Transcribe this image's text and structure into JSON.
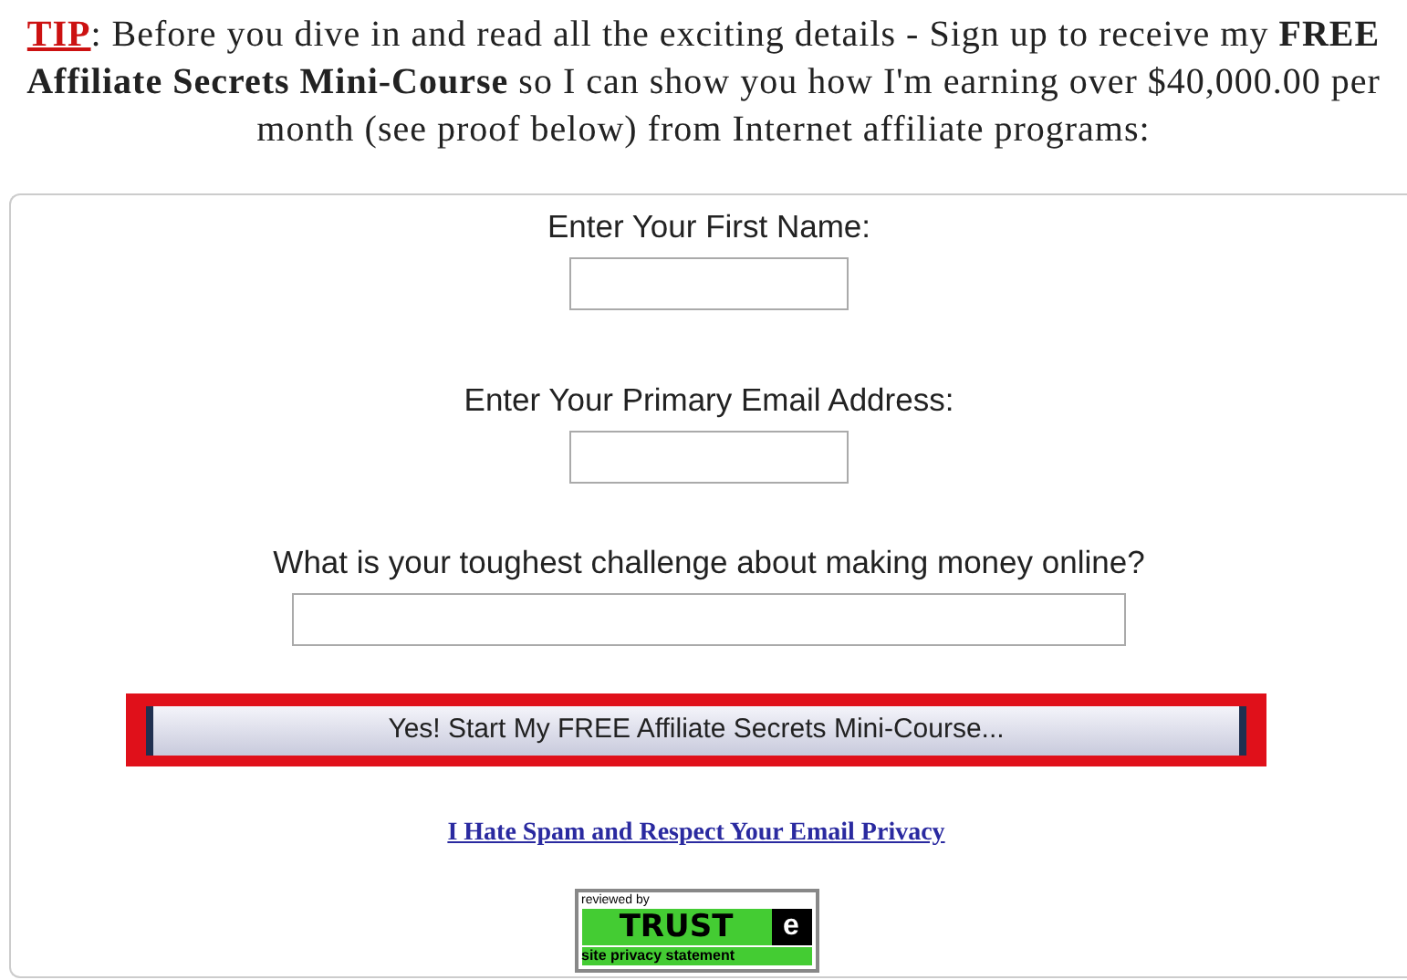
{
  "tip": {
    "label": "TIP",
    "text": ": Before you dive in and read all the exciting details - Sign up to receive my **FREE Affiliate Secrets Mini-Course** so I can show you how I'm earning over $40,000.00 per month (see proof below) from Internet affiliate programs:"
  },
  "form": {
    "fields": [
      {
        "label": "Enter Your First Name:",
        "kind": "short"
      },
      {
        "label": "Enter Your Primary Email Address:",
        "kind": "short"
      },
      {
        "label": "What is your toughest challenge about making money online?",
        "kind": "long"
      }
    ],
    "submit": "Yes! Start My FREE Affiliate Secrets Mini-Course...",
    "privacy_link": "I Hate Spam and Respect Your Email Privacy",
    "badge": {
      "top": "reviewed by",
      "brand": "TRUST",
      "mark": "e",
      "caption": "site privacy statement"
    }
  }
}
